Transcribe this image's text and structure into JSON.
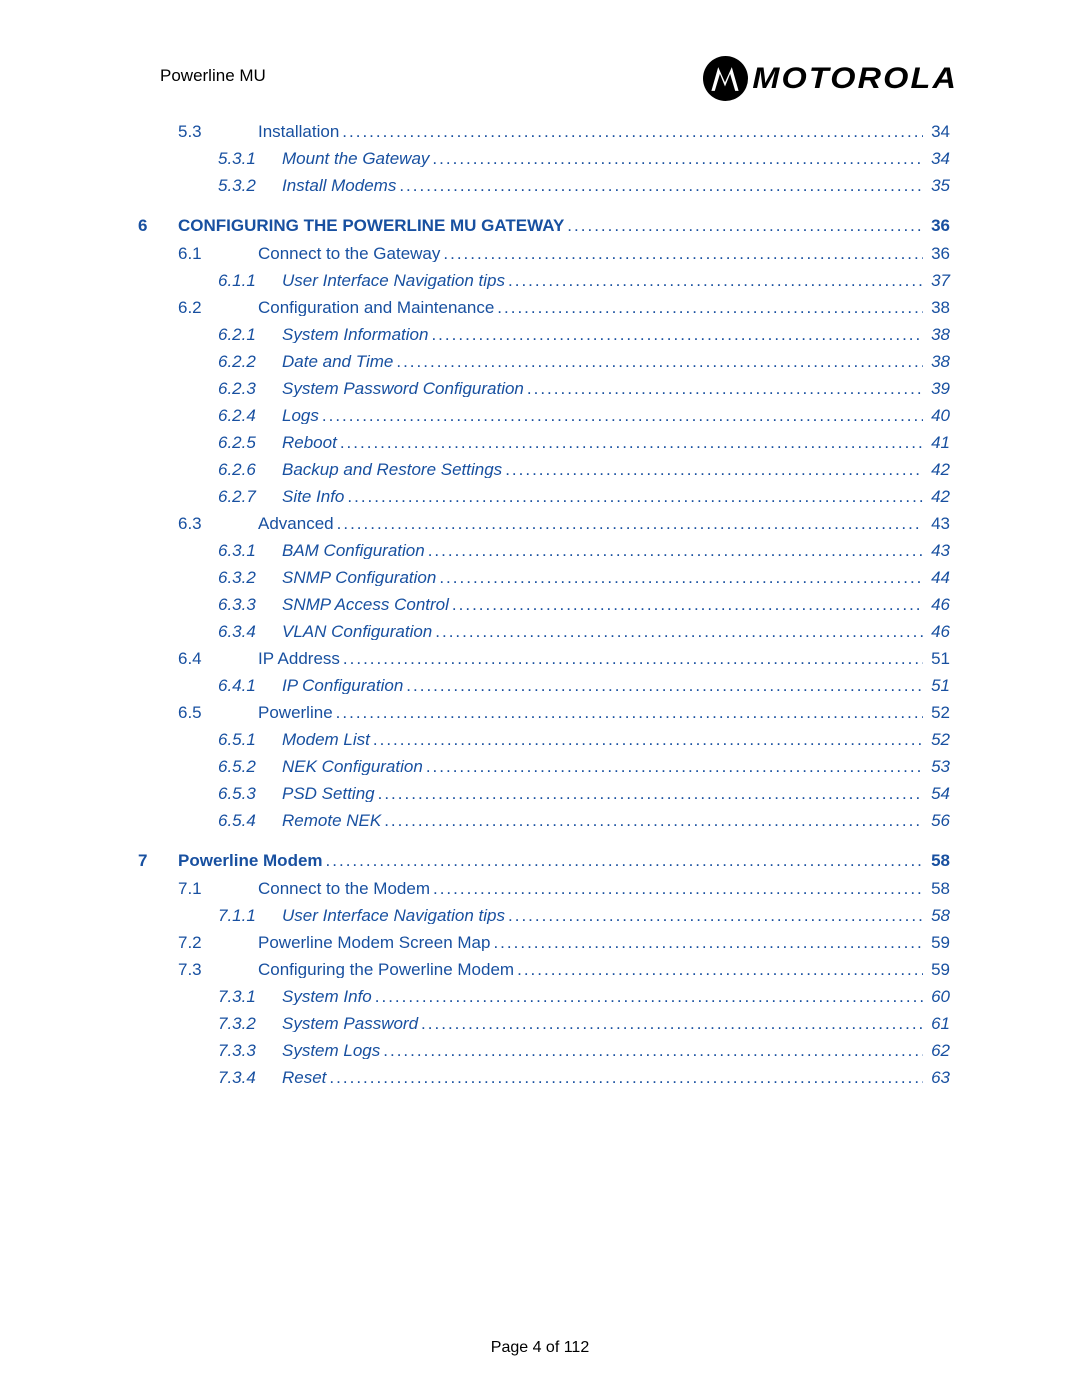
{
  "header": {
    "title": "Powerline MU",
    "logo_word": "MOTOROLA"
  },
  "footer": {
    "text": "Page 4 of 112"
  },
  "toc": [
    {
      "level": "section",
      "num": "5.3",
      "title": "Installation",
      "page": "34"
    },
    {
      "level": "subsection",
      "num": "5.3.1",
      "title": "Mount the Gateway",
      "page": "34"
    },
    {
      "level": "subsection",
      "num": "5.3.2",
      "title": "Install Modems",
      "page": "35"
    },
    {
      "level": "chapter",
      "num": "6",
      "title": "CONFIGURING THE POWERLINE MU GATEWAY",
      "page": "36"
    },
    {
      "level": "section",
      "num": "6.1",
      "title": "Connect to the Gateway",
      "page": "36"
    },
    {
      "level": "subsection",
      "num": "6.1.1",
      "title": "User Interface Navigation tips",
      "page": "37"
    },
    {
      "level": "section",
      "num": "6.2",
      "title": "Configuration and Maintenance",
      "page": "38"
    },
    {
      "level": "subsection",
      "num": "6.2.1",
      "title": "System Information",
      "page": "38"
    },
    {
      "level": "subsection",
      "num": "6.2.2",
      "title": "Date and Time",
      "page": "38"
    },
    {
      "level": "subsection",
      "num": "6.2.3",
      "title": "System Password Configuration",
      "page": "39"
    },
    {
      "level": "subsection",
      "num": "6.2.4",
      "title": "Logs",
      "page": "40"
    },
    {
      "level": "subsection",
      "num": "6.2.5",
      "title": "Reboot",
      "page": "41"
    },
    {
      "level": "subsection",
      "num": "6.2.6",
      "title": "Backup and Restore Settings",
      "page": "42"
    },
    {
      "level": "subsection",
      "num": "6.2.7",
      "title": "Site Info",
      "page": "42"
    },
    {
      "level": "section",
      "num": "6.3",
      "title": "Advanced",
      "page": "43"
    },
    {
      "level": "subsection",
      "num": "6.3.1",
      "title": "BAM Configuration",
      "page": "43"
    },
    {
      "level": "subsection",
      "num": "6.3.2",
      "title": "SNMP Configuration",
      "page": "44"
    },
    {
      "level": "subsection",
      "num": "6.3.3",
      "title": "SNMP Access Control",
      "page": "46"
    },
    {
      "level": "subsection",
      "num": "6.3.4",
      "title": "VLAN Configuration",
      "page": "46"
    },
    {
      "level": "section",
      "num": "6.4",
      "title": "IP Address",
      "page": "51"
    },
    {
      "level": "subsection",
      "num": "6.4.1",
      "title": "IP Configuration",
      "page": "51"
    },
    {
      "level": "section",
      "num": "6.5",
      "title": "Powerline",
      "page": "52"
    },
    {
      "level": "subsection",
      "num": "6.5.1",
      "title": "Modem List",
      "page": "52"
    },
    {
      "level": "subsection",
      "num": "6.5.2",
      "title": "NEK Configuration",
      "page": "53"
    },
    {
      "level": "subsection",
      "num": "6.5.3",
      "title": "PSD Setting",
      "page": "54"
    },
    {
      "level": "subsection",
      "num": "6.5.4",
      "title": "Remote NEK",
      "page": "56"
    },
    {
      "level": "chapter",
      "num": "7",
      "title": "Powerline Modem",
      "page": "58"
    },
    {
      "level": "section",
      "num": "7.1",
      "title": "Connect to the Modem",
      "page": "58"
    },
    {
      "level": "subsection",
      "num": "7.1.1",
      "title": "User Interface Navigation tips",
      "page": "58"
    },
    {
      "level": "section",
      "num": "7.2",
      "title": "Powerline Modem Screen Map",
      "page": "59"
    },
    {
      "level": "section",
      "num": "7.3",
      "title": "Configuring the Powerline Modem",
      "page": "59"
    },
    {
      "level": "subsection",
      "num": "7.3.1",
      "title": "System Info",
      "page": "60"
    },
    {
      "level": "subsection",
      "num": "7.3.2",
      "title": "System Password",
      "page": "61"
    },
    {
      "level": "subsection",
      "num": "7.3.3",
      "title": "System Logs",
      "page": "62"
    },
    {
      "level": "subsection",
      "num": "7.3.4",
      "title": "Reset",
      "page": "63"
    }
  ]
}
